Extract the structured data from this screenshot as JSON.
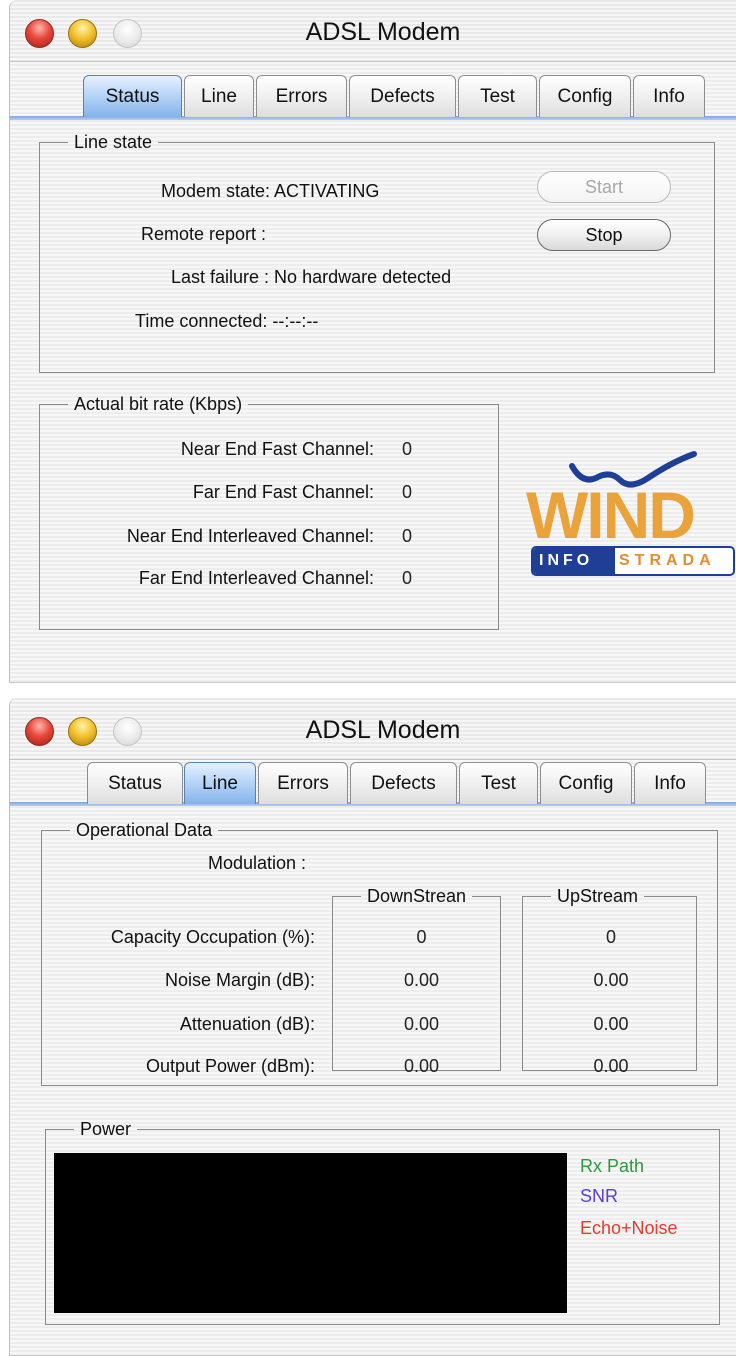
{
  "window1": {
    "title": "ADSL Modem",
    "tabs": [
      {
        "label": "Status",
        "active": true
      },
      {
        "label": "Line",
        "active": false
      },
      {
        "label": "Errors",
        "active": false
      },
      {
        "label": "Defects",
        "active": false
      },
      {
        "label": "Test",
        "active": false
      },
      {
        "label": "Config",
        "active": false
      },
      {
        "label": "Info",
        "active": false
      }
    ],
    "line_state": {
      "legend": "Line state",
      "modem_state": "Modem state: ACTIVATING",
      "remote_report": "Remote report :",
      "last_failure": "Last failure : No hardware detected",
      "time_connected": "Time connected: --:--:--",
      "start_button": "Start",
      "stop_button": "Stop"
    },
    "bit_rate": {
      "legend": "Actual bit rate (Kbps)",
      "rows": [
        {
          "label": "Near End Fast Channel:",
          "value": "0"
        },
        {
          "label": "Far End Fast Channel:",
          "value": "0"
        },
        {
          "label": "Near End Interleaved Channel:",
          "value": "0"
        },
        {
          "label": "Far End Interleaved Channel:",
          "value": "0"
        }
      ]
    },
    "logo": {
      "wind": "WIND",
      "info": "INFO",
      "strada": "STRADA"
    }
  },
  "window2": {
    "title": "ADSL Modem",
    "tabs": [
      {
        "label": "Status",
        "active": false
      },
      {
        "label": "Line",
        "active": true
      },
      {
        "label": "Errors",
        "active": false
      },
      {
        "label": "Defects",
        "active": false
      },
      {
        "label": "Test",
        "active": false
      },
      {
        "label": "Config",
        "active": false
      },
      {
        "label": "Info",
        "active": false
      }
    ],
    "operational": {
      "legend": "Operational Data",
      "modulation_label": "Modulation :",
      "downstream_legend": "DownStrean",
      "upstream_legend": "UpStream",
      "rows": [
        {
          "label": "Capacity Occupation (%):",
          "down": "0",
          "up": "0"
        },
        {
          "label": "Noise Margin (dB):",
          "down": "0.00",
          "up": "0.00"
        },
        {
          "label": "Attenuation (dB):",
          "down": "0.00",
          "up": "0.00"
        },
        {
          "label": "Output Power (dBm):",
          "down": "0.00",
          "up": "0.00"
        }
      ]
    },
    "power": {
      "legend": "Power",
      "legend_items": [
        {
          "label": "Rx Path",
          "color": "#2a9a3a"
        },
        {
          "label": "SNR",
          "color": "#5a3fd1"
        },
        {
          "label": "Echo+Noise",
          "color": "#e23b2f"
        }
      ]
    }
  },
  "colors": {
    "tab_active": "#84b2ea",
    "wind_orange": "#e9a33a",
    "infostrada_blue": "#1f3f97"
  }
}
